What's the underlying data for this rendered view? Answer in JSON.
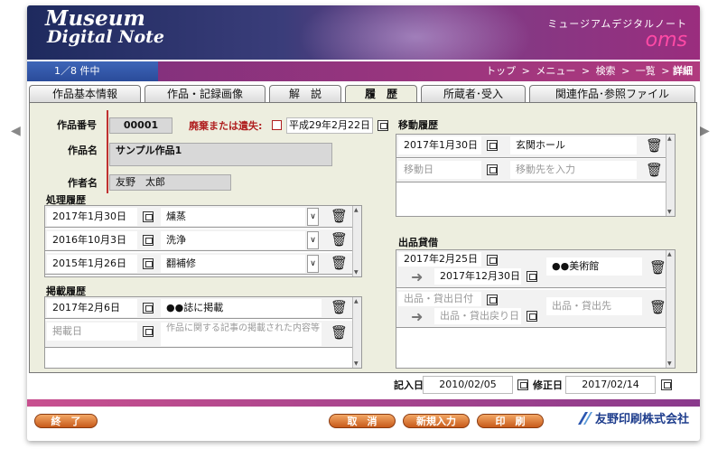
{
  "header": {
    "logo_line1": "Museum",
    "logo_line2": "Digital Note",
    "title_jp": "ミュージアムデジタルノート",
    "brand": "oms"
  },
  "nav": {
    "count": "1／8 件中",
    "crumbs": [
      "トップ",
      "メニュー",
      "検索",
      "一覧"
    ],
    "current": "詳細",
    "sep": ">"
  },
  "tabs": [
    "作品基本情報",
    "作品・記録画像",
    "解　説",
    "履　歴",
    "所蔵者･受入",
    "関連作品･参照ファイル"
  ],
  "active_tab": 3,
  "form": {
    "work_no_label": "作品番号",
    "work_no": "00001",
    "discard_label": "廃棄または遺失:",
    "discard_date": "平成29年2月22日",
    "work_name_label": "作品名",
    "work_name": "サンプル作品1",
    "author_label": "作者名",
    "author": "友野　太郎"
  },
  "processing": {
    "label": "処理履歴",
    "rows": [
      {
        "date": "2017年1月30日",
        "text": "燻蒸"
      },
      {
        "date": "2016年10月3日",
        "text": "洗浄"
      },
      {
        "date": "2015年1月26日",
        "text": "翻補修"
      }
    ]
  },
  "publication": {
    "label": "掲載履歴",
    "rows": [
      {
        "date": "2017年2月6日",
        "text": "●●誌に掲載"
      }
    ],
    "date_placeholder": "掲載日",
    "text_placeholder": "作品に関する記事の掲載された内容等"
  },
  "movement": {
    "label": "移動履歴",
    "rows": [
      {
        "date": "2017年1月30日",
        "place": "玄関ホール"
      }
    ],
    "date_placeholder": "移動日",
    "place_placeholder": "移動先を入力"
  },
  "loan": {
    "label": "出品貸借",
    "rows": [
      {
        "start": "2017年2月25日",
        "end": "2017年12月30日",
        "place": "●●美術館"
      }
    ],
    "start_placeholder": "出品・貸出日付",
    "end_placeholder": "出品・貸出戻り日",
    "place_placeholder": "出品・貸出先"
  },
  "meta": {
    "entry_label": "記入日",
    "entry_date": "2010/02/05",
    "mod_label": "修正日",
    "mod_date": "2017/02/14"
  },
  "buttons": {
    "exit": "終　了",
    "cancel": "取　消",
    "new": "新規入力",
    "print": "印　刷"
  },
  "company": "友野印刷株式会社",
  "icons": {
    "left": "◀",
    "right": "▶",
    "trash": "🗑",
    "dropdown": "∨",
    "arrow": "➜"
  }
}
